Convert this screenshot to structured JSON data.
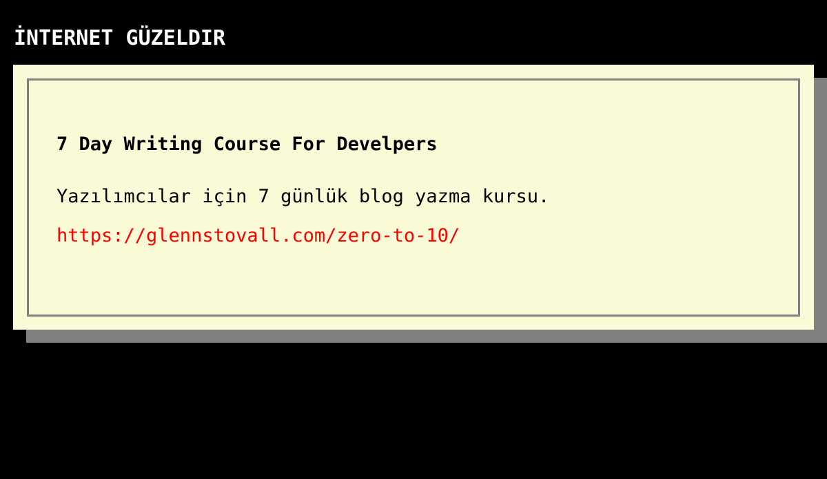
{
  "site": {
    "title": "İNTERNET GÜZELDIR"
  },
  "post": {
    "title": "7 Day Writing Course For Develpers",
    "description": "Yazılımcılar için 7 günlük blog yazma kursu.",
    "link_text": "https://glennstovall.com/zero-to-10/",
    "link_href": "https://glennstovall.com/zero-to-10/"
  },
  "colors": {
    "background": "#000000",
    "card_background": "#fafad6",
    "card_border": "#808080",
    "card_shadow": "#808080",
    "link": "#ff0000",
    "text": "#000000",
    "header_text": "#ffffff"
  }
}
